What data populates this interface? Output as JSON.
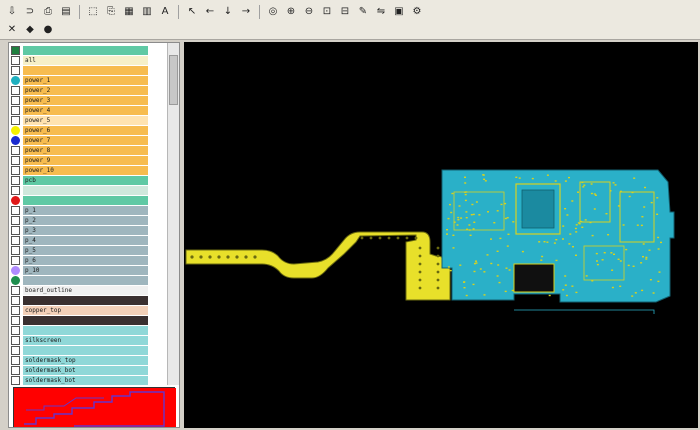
{
  "toolbar": {
    "row1": [
      {
        "icon": "save-icon",
        "glyph": "⇩"
      },
      {
        "icon": "open-icon",
        "glyph": "⊃"
      },
      {
        "icon": "print-icon",
        "glyph": "⎙"
      },
      {
        "icon": "layers-icon",
        "glyph": "▤"
      },
      {
        "icon": "select-icon",
        "glyph": "⬚"
      },
      {
        "icon": "print-preview-icon",
        "glyph": "⎘"
      },
      {
        "icon": "grid-icon",
        "glyph": "▦"
      },
      {
        "icon": "table-icon",
        "glyph": "▥"
      },
      {
        "icon": "text-tool-icon",
        "glyph": "A"
      },
      {
        "icon": "pointer-icon",
        "glyph": "↖"
      },
      {
        "icon": "arrow-left-icon",
        "glyph": "←"
      },
      {
        "icon": "arrow-down-icon",
        "glyph": "↓"
      },
      {
        "icon": "arrow-right-icon",
        "glyph": "→"
      },
      {
        "icon": "zoom-fit-icon",
        "glyph": "◎"
      },
      {
        "icon": "zoom-in-icon",
        "glyph": "⊕"
      },
      {
        "icon": "zoom-out-icon",
        "glyph": "⊖"
      },
      {
        "icon": "zoom-window-icon",
        "glyph": "⊡"
      },
      {
        "icon": "measure-icon",
        "glyph": "⊟"
      },
      {
        "icon": "wrench-icon",
        "glyph": "✎"
      },
      {
        "icon": "flip-icon",
        "glyph": "⇋"
      },
      {
        "icon": "highlight-icon",
        "glyph": "▣"
      },
      {
        "icon": "settings-icon",
        "glyph": "⚙"
      }
    ],
    "row2": [
      {
        "icon": "ratsnest-icon",
        "glyph": "✕"
      },
      {
        "icon": "net-icon",
        "glyph": "◆"
      },
      {
        "icon": "pad-icon",
        "glyph": "●"
      }
    ]
  },
  "layers": [
    {
      "label": "",
      "marker": "box",
      "color": "#5fc9a4",
      "dot": "#1f7f3f"
    },
    {
      "label": "all",
      "marker": "box",
      "color": "#f6f0c8"
    },
    {
      "label": "",
      "marker": "box",
      "color": "#f7bc4f"
    },
    {
      "label": "power_1",
      "marker": "dot",
      "color": "#f7bc4f",
      "dot": "#1fb0c0"
    },
    {
      "label": "power_2",
      "marker": "box",
      "color": "#f7bc4f"
    },
    {
      "label": "power_3",
      "marker": "box",
      "color": "#f7bc4f"
    },
    {
      "label": "power_4",
      "marker": "box",
      "color": "#f7bc4f"
    },
    {
      "label": "power_5",
      "marker": "box",
      "color": "#ffe3b0"
    },
    {
      "label": "power_6",
      "marker": "dot",
      "color": "#f7bc4f",
      "dot": "#f5f000"
    },
    {
      "label": "power_7",
      "marker": "dot",
      "color": "#f7bc4f",
      "dot": "#1a2bd0"
    },
    {
      "label": "power_8",
      "marker": "box",
      "color": "#f7bc4f"
    },
    {
      "label": "power_9",
      "marker": "box",
      "color": "#f7bc4f"
    },
    {
      "label": "power_10",
      "marker": "box",
      "color": "#f7bc4f"
    },
    {
      "label": "pcb",
      "marker": "box",
      "color": "#5fc9a4"
    },
    {
      "label": "",
      "marker": "box",
      "color": "#cfe8dc"
    },
    {
      "label": "",
      "marker": "dot",
      "color": "#5fc9a4",
      "dot": "#e01818"
    },
    {
      "label": "p_1",
      "marker": "box",
      "color": "#9fb6be"
    },
    {
      "label": "p_2",
      "marker": "box",
      "color": "#9fb6be"
    },
    {
      "label": "p_3",
      "marker": "box",
      "color": "#9fb6be"
    },
    {
      "label": "p_4",
      "marker": "box",
      "color": "#9fb6be"
    },
    {
      "label": "p_5",
      "marker": "box",
      "color": "#9fb6be"
    },
    {
      "label": "p_6",
      "marker": "box",
      "color": "#9fb6be"
    },
    {
      "label": "p_10",
      "marker": "dot",
      "color": "#9fb6be",
      "dot": "#b08bff"
    },
    {
      "label": "",
      "marker": "dot",
      "color": "#9fb6be",
      "dot": "#1f8f4f"
    },
    {
      "label": "board_outline",
      "marker": "box",
      "color": "#f0f0f0"
    },
    {
      "label": "",
      "marker": "box",
      "color": "#3a3030"
    },
    {
      "label": "copper_top",
      "marker": "box",
      "color": "#f3d0b8"
    },
    {
      "label": "",
      "marker": "box",
      "color": "#3a3030"
    },
    {
      "label": "",
      "marker": "box",
      "color": "#8fd8d8"
    },
    {
      "label": "silkscreen",
      "marker": "box",
      "color": "#8fd8d8"
    },
    {
      "label": "",
      "marker": "box",
      "color": "#8fd8d8"
    },
    {
      "label": "soldermask_top",
      "marker": "box",
      "color": "#8fd8d8"
    },
    {
      "label": "soldermask_bot",
      "marker": "box",
      "color": "#8fd8d8"
    },
    {
      "label": "soldermask_bot",
      "marker": "box",
      "color": "#8fd8d8"
    }
  ],
  "colors": {
    "flex_yellow": "#e8e02a",
    "board_cyan": "#2ab0c8",
    "component_yellow": "#d8d21e",
    "minimap_red": "#ff0000",
    "minimap_trace": "#6633cc",
    "canvas_bg": "#000000"
  }
}
